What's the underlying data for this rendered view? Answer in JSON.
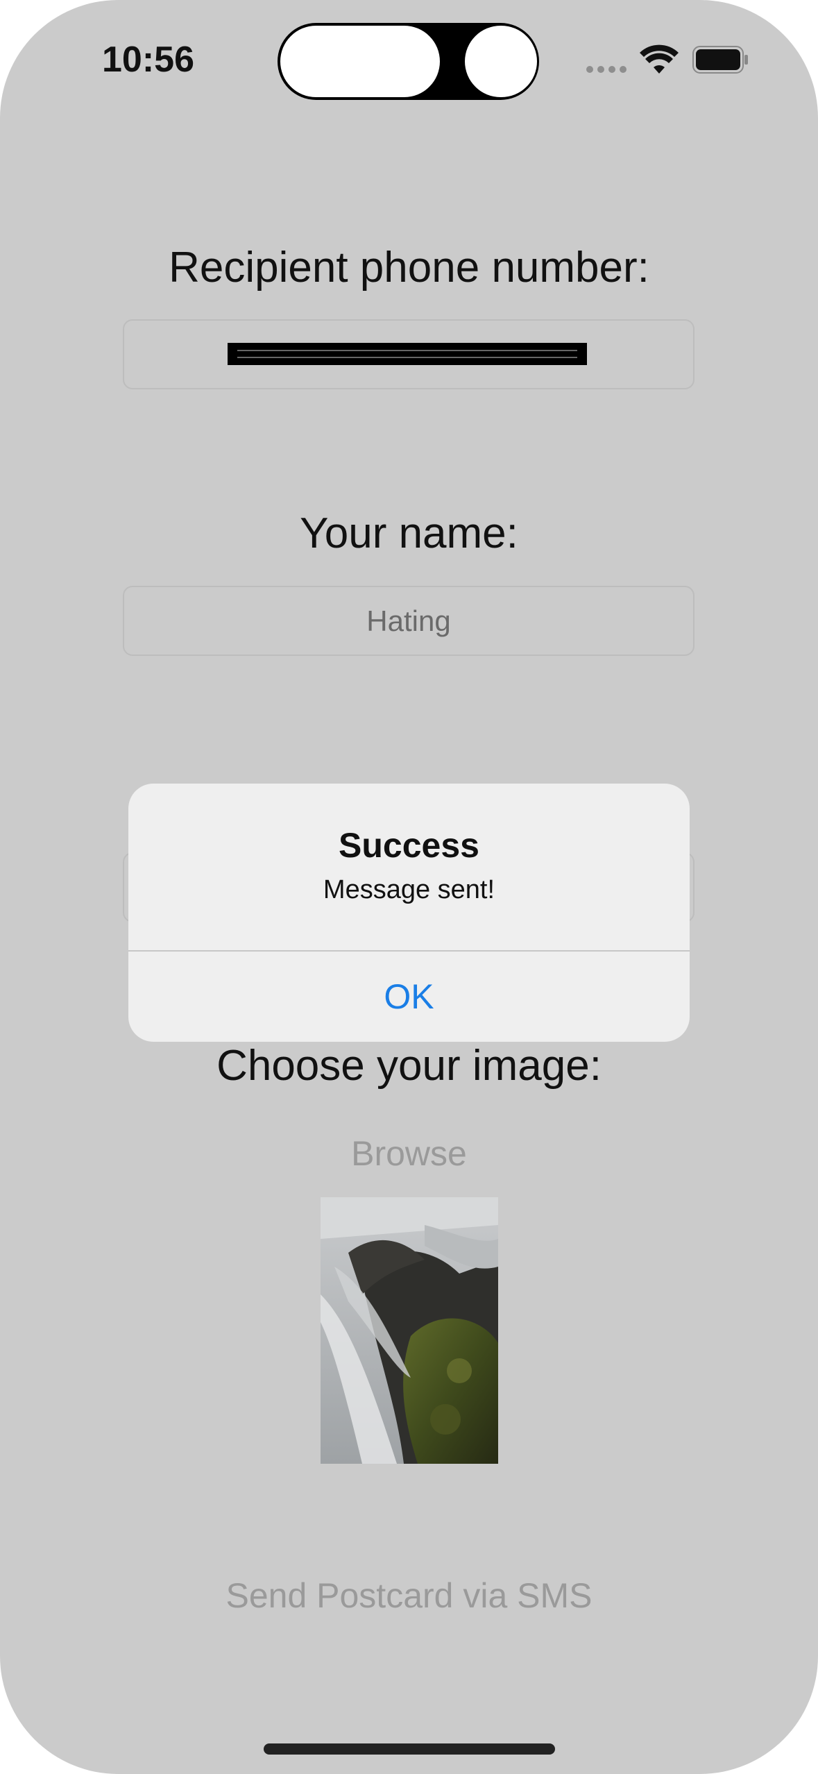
{
  "status_bar": {
    "time": "10:56",
    "icons": [
      "signal-dots-icon",
      "wifi-icon",
      "battery-icon"
    ]
  },
  "form": {
    "phone_label": "Recipient phone number:",
    "phone_value": "",
    "name_label": "Your name:",
    "name_value": "Hating",
    "image_label": "Choose your image:",
    "browse_label": "Browse",
    "send_label": "Send Postcard via SMS"
  },
  "alert": {
    "title": "Success",
    "message": "Message sent!",
    "ok_label": "OK"
  },
  "colors": {
    "background": "#cbcbcb",
    "accent": "#1a7ee6",
    "disabled_text": "#9a9a9a"
  }
}
